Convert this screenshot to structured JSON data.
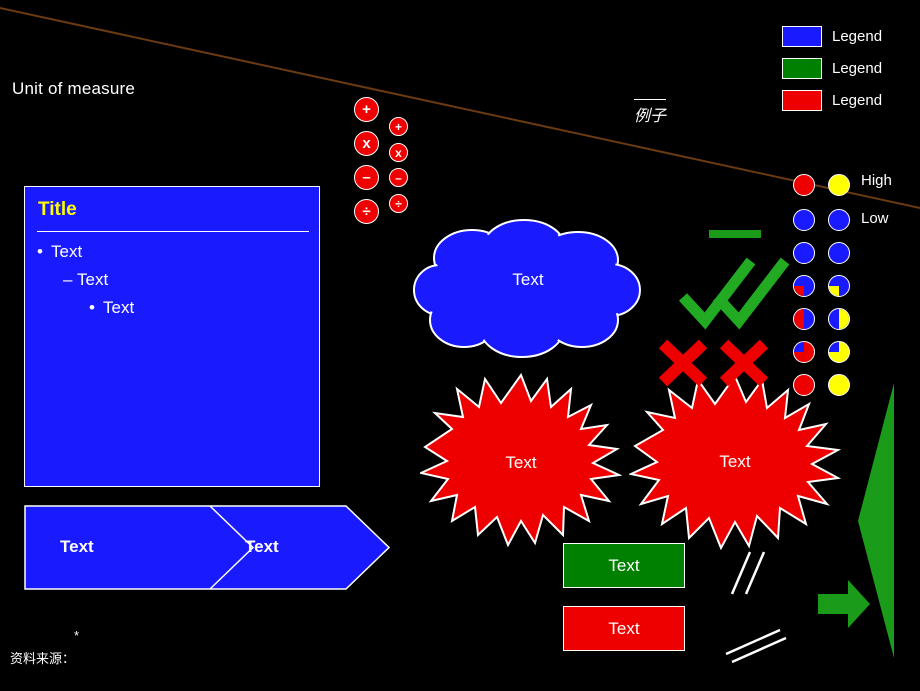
{
  "slide": {
    "unit_of_measure": "Unit of measure",
    "example_cn": "例子",
    "footnote_star": "*",
    "footnote_source": "资料来源："
  },
  "legend": {
    "items": [
      {
        "label": "Legend",
        "color": "#1a1aff",
        "icon": "blue-swatch"
      },
      {
        "label": "Legend",
        "color": "#008000",
        "icon": "green-swatch"
      },
      {
        "label": "Legend",
        "color": "#ee0000",
        "icon": "red-swatch"
      }
    ]
  },
  "title_box": {
    "title": "Title",
    "bullet_level1": "Text",
    "bullet_level2": "Text",
    "bullet_level3": "Text",
    "bullet_marks": {
      "l1": "•",
      "l2": "–",
      "l3": "•"
    },
    "fill": "#1a1aff",
    "title_color": "#ffff00"
  },
  "chevron": {
    "text_left": "Text",
    "text_right": "Text",
    "fill": "#1a1aff"
  },
  "operators": {
    "large": [
      {
        "symbol": "+",
        "name": "plus"
      },
      {
        "symbol": "x",
        "name": "times"
      },
      {
        "symbol": "–",
        "name": "minus"
      },
      {
        "symbol": "÷",
        "name": "divide"
      }
    ],
    "small": [
      {
        "symbol": "+",
        "name": "plus"
      },
      {
        "symbol": "x",
        "name": "times"
      },
      {
        "symbol": "–",
        "name": "minus"
      },
      {
        "symbol": "÷",
        "name": "divide"
      }
    ],
    "color": "#ee0000"
  },
  "cloud": {
    "text": "Text",
    "fill": "#1a1aff"
  },
  "explosions": [
    {
      "text": "Text",
      "fill": "#ee0000"
    },
    {
      "text": "Text",
      "fill": "#ee0000"
    }
  ],
  "marks": {
    "checks": [
      {
        "name": "check-mark",
        "color": "#22aa22"
      },
      {
        "name": "check-mark",
        "color": "#22aa22"
      }
    ],
    "crosses": [
      {
        "name": "cross-mark",
        "color": "#ee0000"
      },
      {
        "name": "cross-mark",
        "color": "#ee0000"
      }
    ]
  },
  "harvey_scale": {
    "high_label": "High",
    "low_label": "Low",
    "colors": {
      "red": "#ee0000",
      "yellow": "#ffff00",
      "blue": "#1a1aff"
    }
  },
  "color_boxes": [
    {
      "text": "Text",
      "fill": "#008000"
    },
    {
      "text": "Text",
      "fill": "#ee0000"
    }
  ],
  "green_shapes": {
    "bar": "#1a9c1a",
    "tall_arrow": "#1a9c1a",
    "right_arrow": "#1a9c1a"
  }
}
